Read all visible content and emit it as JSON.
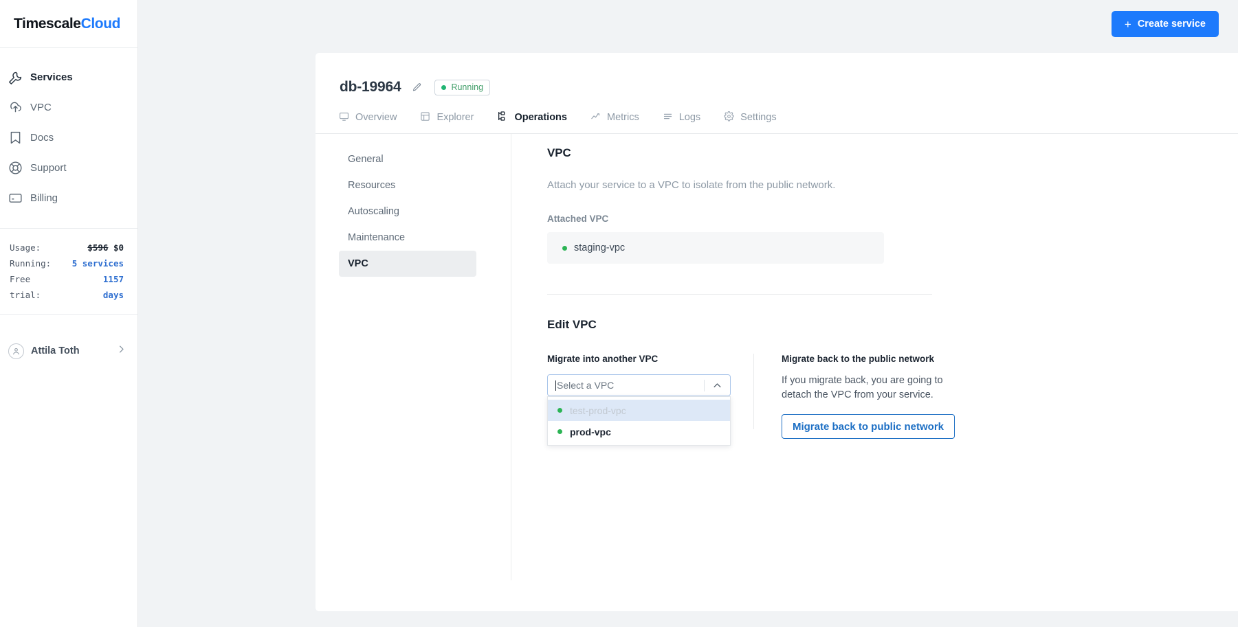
{
  "brand": {
    "name_dark": "Timescale",
    "name_blue": "Cloud"
  },
  "sidebar": {
    "items": [
      {
        "label": "Services",
        "icon": "wrench-icon",
        "active": true
      },
      {
        "label": "VPC",
        "icon": "cloud-upload-icon",
        "active": false
      },
      {
        "label": "Docs",
        "icon": "bookmark-icon",
        "active": false
      },
      {
        "label": "Support",
        "icon": "lifebuoy-icon",
        "active": false
      },
      {
        "label": "Billing",
        "icon": "credit-card-icon",
        "active": false
      }
    ],
    "usage": {
      "usage_label": "Usage:",
      "usage_old": "$596",
      "usage_new": "$0",
      "running_label": "Running:",
      "running_value": "5 services",
      "free_trial_label_line1": "Free",
      "free_trial_label_line2": "trial:",
      "free_trial_value_line1": "1157",
      "free_trial_value_line2": "days"
    },
    "user": {
      "name": "Attila Toth"
    }
  },
  "topbar": {
    "create_service_label": "Create service",
    "plus": "+"
  },
  "service": {
    "title": "db-19964",
    "status": "Running",
    "status_color": "#22b573"
  },
  "tabs": [
    {
      "label": "Overview",
      "icon": "monitor-icon",
      "active": false
    },
    {
      "label": "Explorer",
      "icon": "table-icon",
      "active": false
    },
    {
      "label": "Operations",
      "icon": "flow-icon",
      "active": true
    },
    {
      "label": "Metrics",
      "icon": "chart-line-icon",
      "active": false
    },
    {
      "label": "Logs",
      "icon": "list-icon",
      "active": false
    },
    {
      "label": "Settings",
      "icon": "gear-icon",
      "active": false
    }
  ],
  "subnav": [
    {
      "label": "General",
      "active": false
    },
    {
      "label": "Resources",
      "active": false
    },
    {
      "label": "Autoscaling",
      "active": false
    },
    {
      "label": "Maintenance",
      "active": false
    },
    {
      "label": "VPC",
      "active": true
    }
  ],
  "vpc": {
    "heading": "VPC",
    "description": "Attach your service to a VPC to isolate from the public network.",
    "attached_label": "Attached VPC",
    "attached_name": "staging-vpc",
    "edit_heading": "Edit VPC",
    "migrate_label": "Migrate into another VPC",
    "select_placeholder": "Select a VPC",
    "options": [
      {
        "name": "test-prod-vpc",
        "disabled": true,
        "highlighted": true
      },
      {
        "name": "prod-vpc",
        "disabled": false,
        "highlighted": false
      }
    ],
    "public": {
      "heading": "Migrate back to the public network",
      "description": "If you migrate back, you are going to detach the VPC from your service.",
      "button_label": "Migrate back to public network"
    }
  },
  "colors": {
    "accent_blue": "#1d7afc",
    "green": "#22b573",
    "page_bg": "#f1f3f5",
    "highlight": "#dde8f7"
  }
}
